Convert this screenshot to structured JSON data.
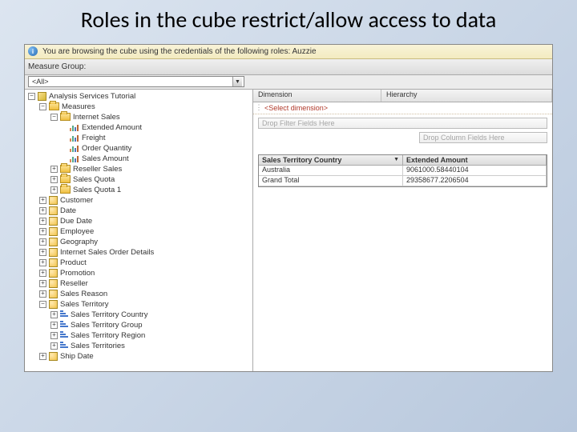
{
  "slide": {
    "title": "Roles in the cube restrict/allow access to data"
  },
  "infobar": {
    "text": "You are browsing the cube using the credentials of the following roles: Auzzie"
  },
  "toolbar": {
    "measure_group_label": "Measure Group:",
    "measure_group_value": "<All>"
  },
  "grid": {
    "dimension_header": "Dimension",
    "hierarchy_header": "Hierarchy",
    "select_dim": "<Select dimension>"
  },
  "pivot": {
    "drop_filter": "Drop Filter Fields Here",
    "drop_column": "Drop Column Fields Here",
    "row_header": "Sales Territory Country",
    "col_header": "Extended Amount",
    "rows": [
      {
        "label": "Australia",
        "value": "9061000.58440104"
      },
      {
        "label": "Grand Total",
        "value": "29358677.2206504"
      }
    ]
  },
  "tree": {
    "root": "Analysis Services Tutorial",
    "measures_label": "Measures",
    "internet_sales": "Internet Sales",
    "m1": "Extended Amount",
    "m2": "Freight",
    "m3": "Order Quantity",
    "m4": "Sales Amount",
    "g1": "Reseller Sales",
    "g2": "Sales Quota",
    "g3": "Sales Quota 1",
    "d_customer": "Customer",
    "d_date": "Date",
    "d_duedate": "Due Date",
    "d_employee": "Employee",
    "d_geography": "Geography",
    "d_isod": "Internet Sales Order Details",
    "d_product": "Product",
    "d_promotion": "Promotion",
    "d_reseller": "Reseller",
    "d_salesreason": "Sales Reason",
    "d_salesterritory": "Sales Territory",
    "h1": "Sales Territory Country",
    "h2": "Sales Territory Group",
    "h3": "Sales Territory Region",
    "h4": "Sales Territories",
    "d_shipdate": "Ship Date"
  }
}
